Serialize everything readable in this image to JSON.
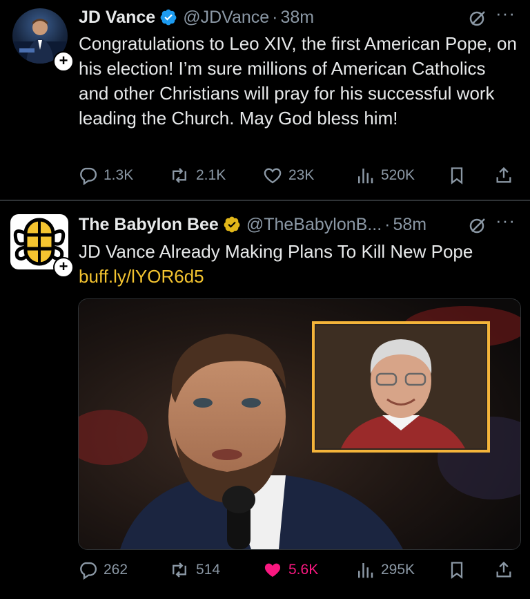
{
  "tweets": [
    {
      "name": "JD Vance",
      "handle": "@JDVance",
      "dot": "·",
      "time": "38m",
      "text": "Congratulations to Leo XIV, the first American Pope, on his election! I’m sure millions of American Catholics and other Christians will pray for his successful work leading the Church. May God bless him!",
      "replies": "1.3K",
      "reposts": "2.1K",
      "likes": "23K",
      "views": "520K",
      "verified_color": "#1d9bf0"
    },
    {
      "name": "The Babylon Bee",
      "handle": "@TheBabylonB...",
      "dot": "·",
      "time": "58m",
      "text": "JD Vance Already Making Plans To Kill New Pope",
      "link": "buff.ly/lYOR6d5",
      "replies": "262",
      "reposts": "514",
      "likes": "5.6K",
      "views": "295K",
      "verified_color": "#e2b719",
      "liked": true
    }
  ],
  "icons": {
    "reply": "reply-icon",
    "repost": "repost-icon",
    "like": "heart-icon",
    "views": "views-icon",
    "bookmark": "bookmark-icon",
    "share": "share-icon",
    "grok": "grok-icon",
    "more": "more-icon",
    "follow": "plus-icon"
  },
  "more_glyph": "···",
  "plus_glyph": "+",
  "colors": {
    "background": "#000000",
    "text": "#e7e9ea",
    "muted": "#8b98a5",
    "link": "#f4c430",
    "like": "#f91880"
  }
}
